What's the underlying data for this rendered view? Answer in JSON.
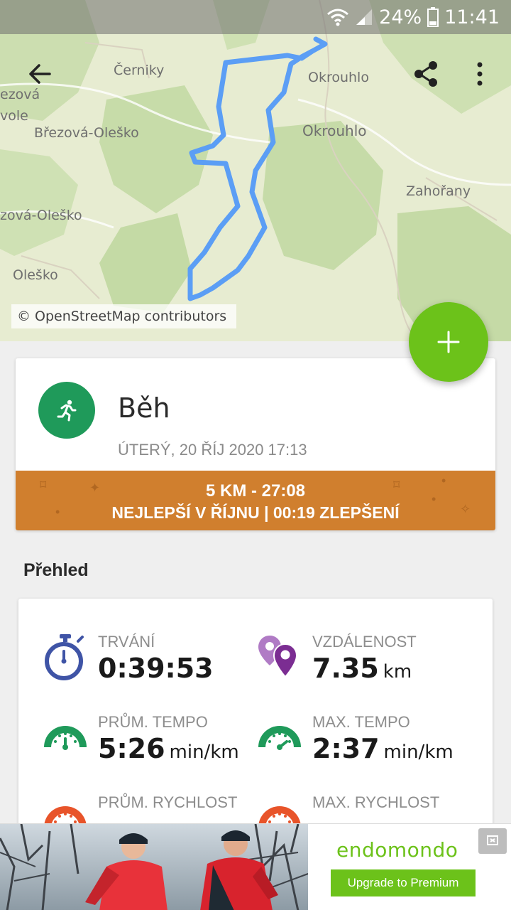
{
  "status_bar": {
    "battery": "24%",
    "time": "11:41"
  },
  "toolbar": {
    "back_icon": "arrow-left-icon",
    "share_icon": "share-icon",
    "more_icon": "more-vertical-icon"
  },
  "map": {
    "labels": {
      "cerniky": "Černiky",
      "ova": "ezová",
      "vole": "vole",
      "brezova1": "Březová-Oleško",
      "brezova2": "zová-Oleško",
      "olesko": "Oleško",
      "okrouhlo1": "Okrouhlo",
      "okrouhlo2": "Okrouhlo",
      "zahorany": "Zahořany"
    },
    "attribution": "© OpenStreetMap contributors",
    "route_color": "#5b9ef5"
  },
  "fab": {
    "icon": "plus-icon"
  },
  "activity": {
    "sport": "Běh",
    "sport_icon": "running-icon",
    "date": "ÚTERÝ, 20 ŘÍJ 2020 17:13",
    "record_line1": "5 KM  -  27:08",
    "record_line2": "NEJLEPŠÍ V ŘÍJNU  |  00:19 ZLEPŠENÍ",
    "record_color": "#d07f2e"
  },
  "overview": {
    "title": "Přehled",
    "stats": [
      {
        "label": "TRVÁNÍ",
        "value": "0:39:53",
        "unit": "",
        "icon": "stopwatch-icon"
      },
      {
        "label": "VZDÁLENOST",
        "value": "7.35",
        "unit": "km",
        "icon": "location-pins-icon"
      },
      {
        "label": "PRŮM. TEMPO",
        "value": "5:26",
        "unit": "min/km",
        "icon": "speedometer-icon"
      },
      {
        "label": "MAX. TEMPO",
        "value": "2:37",
        "unit": "min/km",
        "icon": "speedometer-icon"
      },
      {
        "label": "PRŮM. RYCHLOST",
        "value": "",
        "unit": "",
        "icon": "speedometer-icon"
      },
      {
        "label": "MAX. RYCHLOST",
        "value": "",
        "unit": "",
        "icon": "speedometer-icon"
      }
    ]
  },
  "ad": {
    "brand": "endomondo",
    "cta": "Upgrade to Premium"
  }
}
